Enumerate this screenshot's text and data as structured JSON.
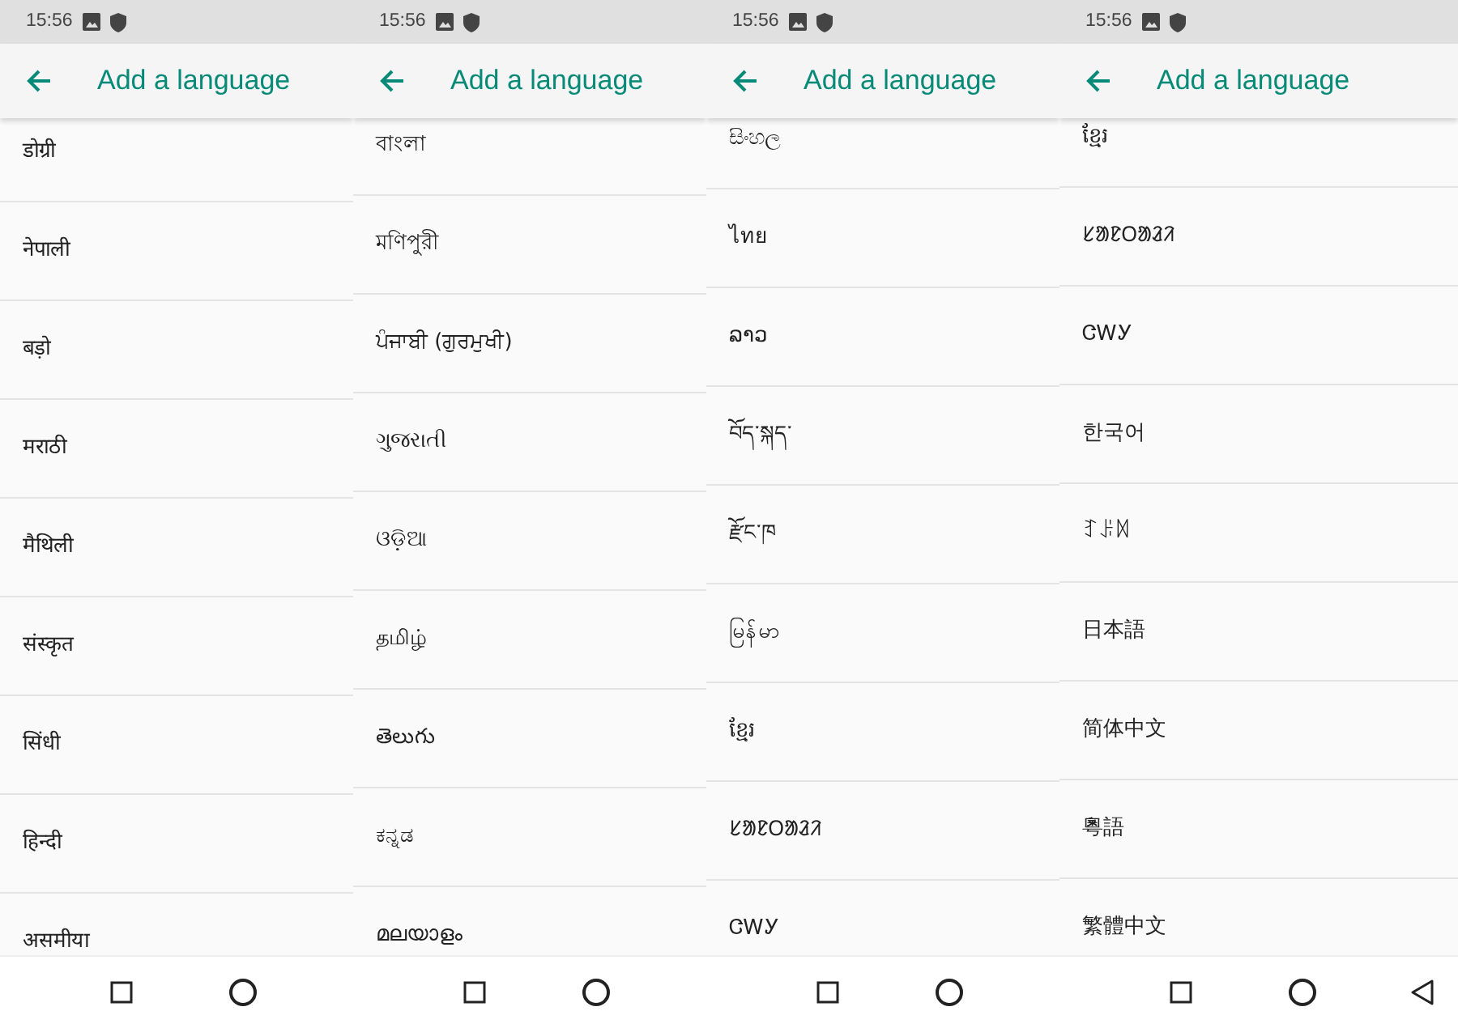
{
  "screens": [
    {
      "status_bar": {
        "time": "15:56"
      },
      "app_bar": {
        "title": "Add a language"
      },
      "languages": [
        "डोग्री",
        "नेपाली",
        "बड़ो",
        "मराठी",
        "मैथिली",
        "संस्कृत",
        "सिंधी",
        "हिन्दी",
        "असमीया"
      ],
      "nav_buttons": [
        {
          "kind": "recents"
        },
        {
          "kind": "home"
        }
      ]
    },
    {
      "status_bar": {
        "time": "15:56"
      },
      "app_bar": {
        "title": "Add a language"
      },
      "languages": [
        "বাংলা",
        "মণিপুরী",
        "ਪੰਜਾਬੀ (ਗੁਰਮੁਖੀ)",
        "ગુજરાતી",
        "ଓଡ଼ିଆ",
        "தமிழ்",
        "తెలుగు",
        "ಕನ್ನಡ",
        "മലയാളം"
      ],
      "nav_buttons": [
        {
          "kind": "recents"
        },
        {
          "kind": "home"
        }
      ]
    },
    {
      "status_bar": {
        "time": "15:56"
      },
      "app_bar": {
        "title": "Add a language"
      },
      "languages": [
        "සිංහල",
        "ไทย",
        "ລາວ",
        "བོད་སྐད་",
        "རྫོང་ཁ",
        "မြန်မာ",
        "ខ្មែរ",
        "ᱥᱟᱱᱛᱟᱲᱤ",
        "ᏣᎳᎩ"
      ],
      "nav_buttons": [
        {
          "kind": "recents"
        },
        {
          "kind": "home"
        }
      ]
    },
    {
      "status_bar": {
        "time": "15:56"
      },
      "app_bar": {
        "title": "Add a language"
      },
      "languages": [
        "ខ្មែរ",
        "ᱥᱟᱱᱛᱟᱲᱤ",
        "ᏣᎳᎩ",
        "한국어",
        "ꆈꌠꉙ",
        "日本語",
        "简体中文",
        "粵語",
        "繁體中文"
      ],
      "nav_buttons": [
        {
          "kind": "recents"
        },
        {
          "kind": "home"
        },
        {
          "kind": "back"
        }
      ]
    }
  ]
}
